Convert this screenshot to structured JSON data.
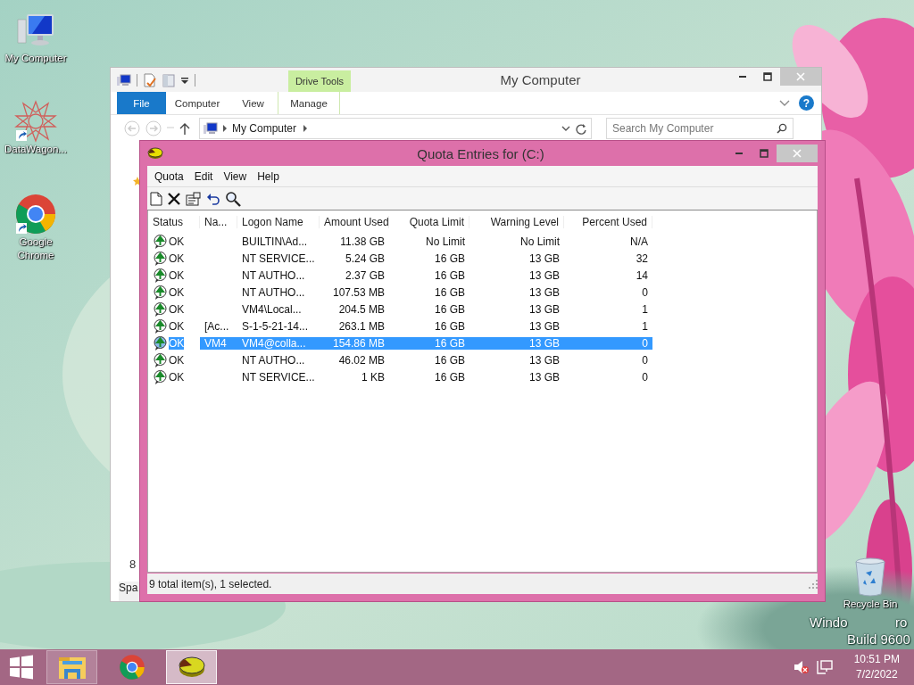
{
  "desktop_icons": [
    {
      "kind": "computer",
      "label": "My Computer"
    },
    {
      "kind": "datawagon",
      "label": "DataWagon..."
    },
    {
      "kind": "chrome",
      "label": "Google Chrome"
    },
    {
      "kind": "recycle",
      "label": "Recycle Bin"
    }
  ],
  "os_watermark": {
    "line_1_left": "Windo",
    "line_1_right": "ro",
    "line_2": "Build 9600"
  },
  "explorer": {
    "title": "My Computer",
    "contextual_group": "Drive Tools",
    "ribbon_tabs": [
      {
        "kind": "file",
        "label": "File"
      },
      {
        "kind": "tab",
        "label": "Computer"
      },
      {
        "kind": "tab",
        "label": "View"
      },
      {
        "kind": "contextual",
        "label": "Manage"
      }
    ],
    "help_glyph": "?",
    "address": "My Computer",
    "search": {
      "placeholder": "Search My Computer"
    },
    "item_count": "8",
    "status_fragment": "Spa"
  },
  "quota": {
    "title": "Quota Entries for  (C:)",
    "menu": [
      "Quota",
      "Edit",
      "View",
      "Help"
    ],
    "toolbar": [
      {
        "kind": "new"
      },
      {
        "kind": "delete"
      },
      {
        "kind": "properties"
      },
      {
        "kind": "undo"
      },
      {
        "kind": "find"
      }
    ],
    "columns": [
      "Status",
      "Na...",
      "Logon Name",
      "Amount Used",
      "Quota Limit",
      "Warning Level",
      "Percent Used"
    ],
    "rows": [
      {
        "selected": false,
        "cells": [
          "OK",
          "",
          "BUILTIN\\Ad...",
          "11.38 GB",
          "No Limit",
          "No Limit",
          "N/A"
        ]
      },
      {
        "selected": false,
        "cells": [
          "OK",
          "",
          "NT SERVICE...",
          "5.24 GB",
          "16 GB",
          "13 GB",
          "32"
        ]
      },
      {
        "selected": false,
        "cells": [
          "OK",
          "",
          "NT AUTHO...",
          "2.37 GB",
          "16 GB",
          "13 GB",
          "14"
        ]
      },
      {
        "selected": false,
        "cells": [
          "OK",
          "",
          "NT AUTHO...",
          "107.53 MB",
          "16 GB",
          "13 GB",
          "0"
        ]
      },
      {
        "selected": false,
        "cells": [
          "OK",
          "",
          "VM4\\Local...",
          "204.5 MB",
          "16 GB",
          "13 GB",
          "1"
        ]
      },
      {
        "selected": false,
        "cells": [
          "OK",
          "[Ac...",
          "S-1-5-21-14...",
          "263.1 MB",
          "16 GB",
          "13 GB",
          "1"
        ]
      },
      {
        "selected": true,
        "cells": [
          "OK",
          "VM4",
          "VM4@colla...",
          "154.86 MB",
          "16 GB",
          "13 GB",
          "0"
        ]
      },
      {
        "selected": false,
        "cells": [
          "OK",
          "",
          "NT AUTHO...",
          "46.02 MB",
          "16 GB",
          "13 GB",
          "0"
        ]
      },
      {
        "selected": false,
        "cells": [
          "OK",
          "",
          "NT SERVICE...",
          "1 KB",
          "16 GB",
          "13 GB",
          "0"
        ]
      }
    ],
    "status_bar": "9 total item(s), 1 selected."
  },
  "taskbar": {
    "apps": [
      {
        "kind": "explorer",
        "running": true,
        "active": false
      },
      {
        "kind": "chrome",
        "running": false,
        "active": false
      },
      {
        "kind": "quota",
        "running": true,
        "active": true
      }
    ],
    "time": "10:51 PM",
    "date": "7/2/2022"
  }
}
